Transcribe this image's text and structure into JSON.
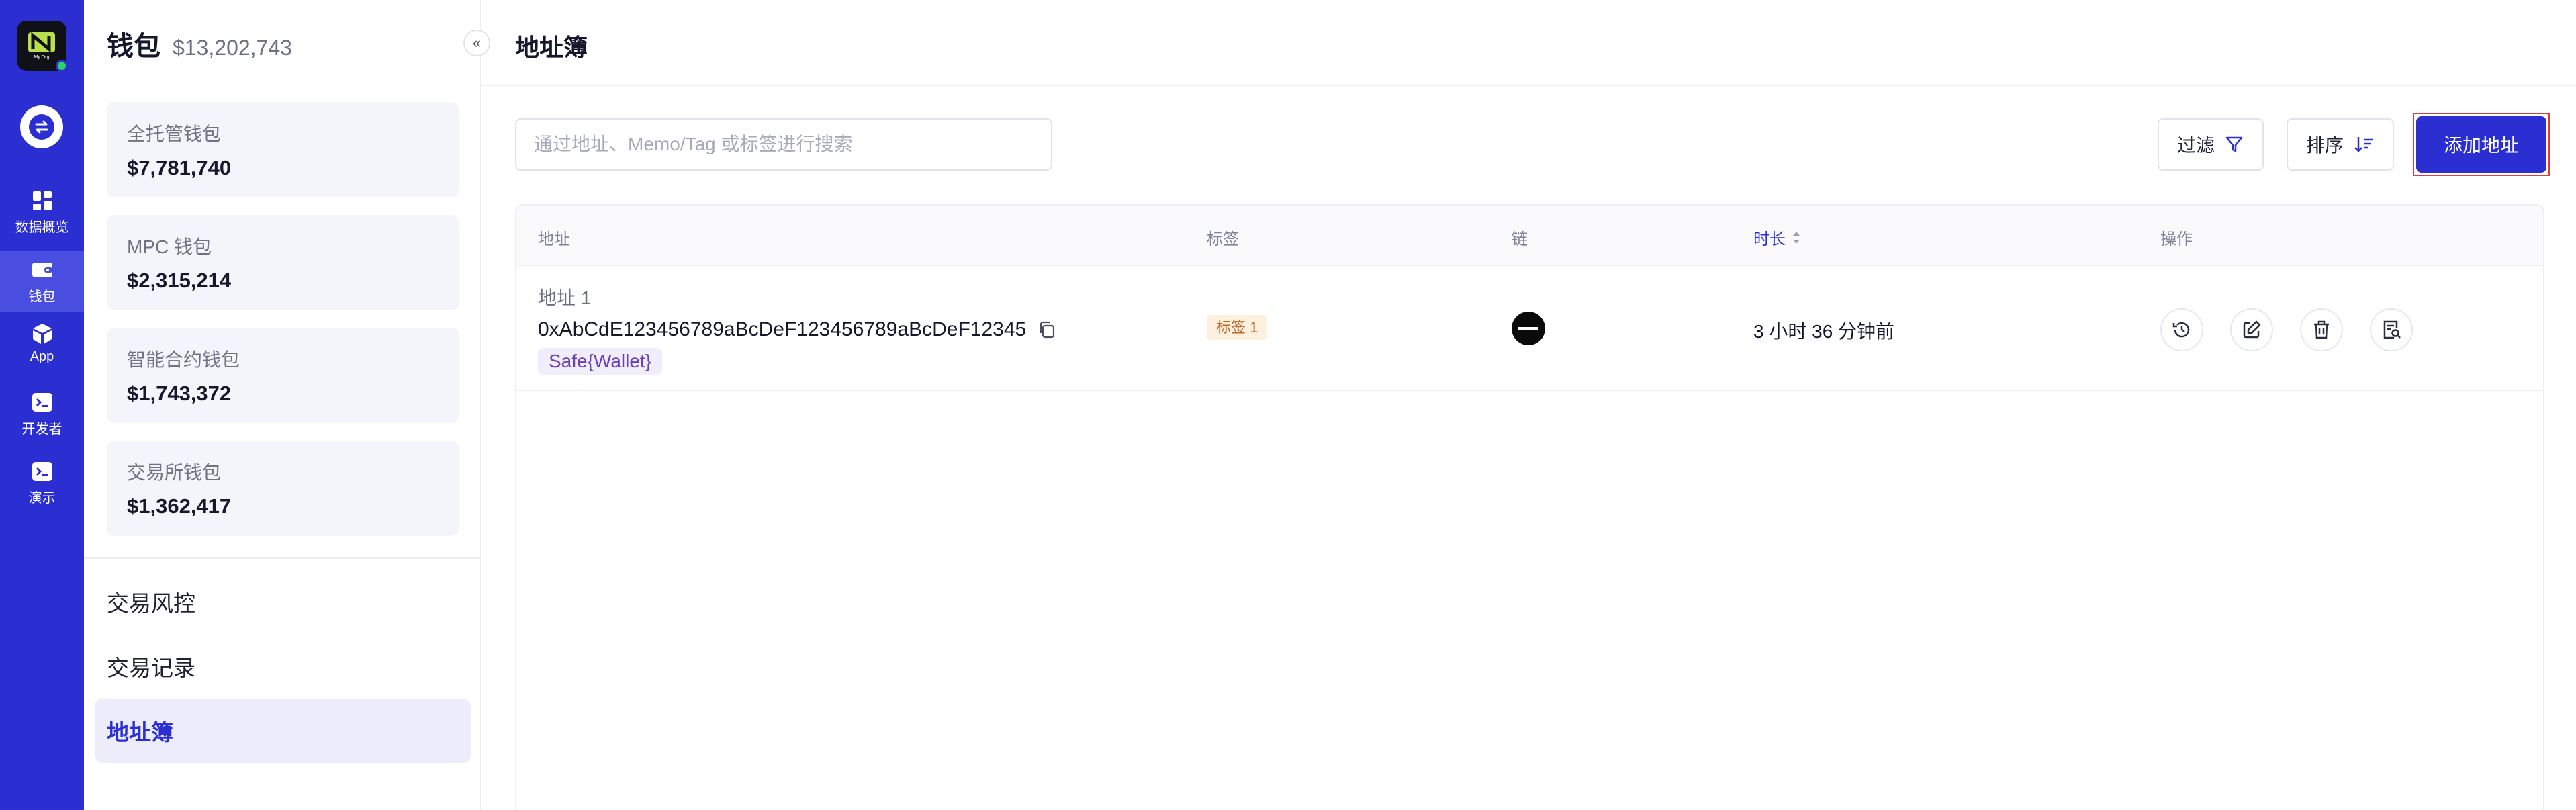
{
  "rail": {
    "logo_text": "My Org",
    "items": [
      {
        "label": "数据概览",
        "icon": "dashboard-icon"
      },
      {
        "label": "钱包",
        "icon": "wallet-icon"
      },
      {
        "label": "App",
        "icon": "app-cube-icon"
      },
      {
        "label": "开发者",
        "icon": "terminal-icon"
      },
      {
        "label": "演示",
        "icon": "terminal-icon"
      }
    ]
  },
  "panel": {
    "title": "钱包",
    "total": "$13,202,743",
    "wallets": [
      {
        "name": "全托管钱包",
        "amount": "$7,781,740"
      },
      {
        "name": "MPC 钱包",
        "amount": "$2,315,214"
      },
      {
        "name": "智能合约钱包",
        "amount": "$1,743,372"
      },
      {
        "name": "交易所钱包",
        "amount": "$1,362,417"
      }
    ],
    "menu": [
      "交易风控",
      "交易记录",
      "地址簿"
    ],
    "active_menu": "地址簿"
  },
  "main": {
    "title": "地址簿",
    "search_placeholder": "通过地址、Memo/Tag 或标签进行搜索",
    "filter_label": "过滤",
    "sort_label": "排序",
    "add_label": "添加地址",
    "columns": [
      "地址",
      "标签",
      "链",
      "时长",
      "操作"
    ],
    "sorted_column": "时长",
    "rows": [
      {
        "name": "地址 1",
        "address": "0xAbCdE123456789aBcDeF123456789aBcDeF12345",
        "wallet_tag": "Safe{Wallet}",
        "label": "标签 1",
        "chain_icon": "chain-circle-icon",
        "time": "3 小时 36 分钟前"
      }
    ],
    "actions": [
      "history-icon",
      "edit-icon",
      "trash-icon",
      "search-doc-icon"
    ]
  },
  "colors": {
    "brand": "#2b2fd1",
    "highlight": "#e03b3b"
  }
}
